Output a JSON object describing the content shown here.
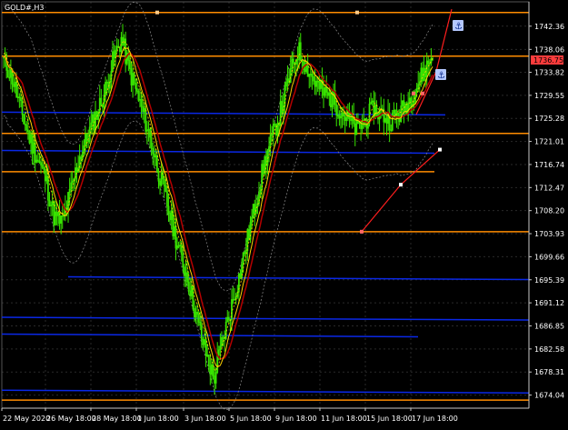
{
  "symbol_label": "GOLD#,H3",
  "current_price_label": "1736.75",
  "colors": {
    "background": "#000000",
    "grid": "#2a2a2a",
    "axis": "#c8c8c8",
    "candle": "#39e600",
    "ma_red": "#b40000",
    "ma_yellow": "#ffd200",
    "band": "#8c8c8c",
    "orange_line": "#ff8c00",
    "blue_line": "#0a28e6",
    "red_trend": "#ff1e1e",
    "price_tag_bg": "#ff3c3c",
    "icon_bg": "#b4c8ff"
  },
  "chart_data": {
    "type": "candlestick",
    "ylim": [
      1671.61,
      1746.87
    ],
    "y_ticks": [
      1742.36,
      1738.06,
      1733.82,
      1729.55,
      1725.28,
      1721.01,
      1716.74,
      1712.47,
      1708.2,
      1703.93,
      1699.66,
      1695.39,
      1691.12,
      1686.85,
      1682.58,
      1678.31,
      1674.04
    ],
    "x_ticks": [
      "22 May 2020",
      "26 May 18:00",
      "28 May 18:00",
      "1 Jun 18:00",
      "3 Jun 18:00",
      "5 Jun 18:00",
      "9 Jun 18:00",
      "11 Jun 18:00",
      "15 Jun 18:00",
      "17 Jun 18:00"
    ],
    "grid": true,
    "price_path": [
      1736,
      1733,
      1727,
      1722,
      1718,
      1714,
      1707,
      1706,
      1712,
      1718,
      1722,
      1726,
      1730,
      1736,
      1740,
      1734,
      1729,
      1724,
      1718,
      1712,
      1706,
      1700,
      1695,
      1688,
      1682,
      1677,
      1684,
      1690,
      1696,
      1703,
      1710,
      1717,
      1722,
      1727,
      1733,
      1738,
      1735,
      1732,
      1730,
      1729,
      1727,
      1725,
      1723,
      1725,
      1727,
      1726,
      1725,
      1726,
      1728,
      1731,
      1734,
      1737
    ],
    "levels": {
      "orange": [
        1744.9,
        1736.8,
        1722.5,
        1715.4,
        1704.3,
        1673.1
      ],
      "blue": [
        1726.1,
        1719.0,
        1695.6,
        1688.1,
        1685.0,
        1674.6
      ]
    }
  }
}
